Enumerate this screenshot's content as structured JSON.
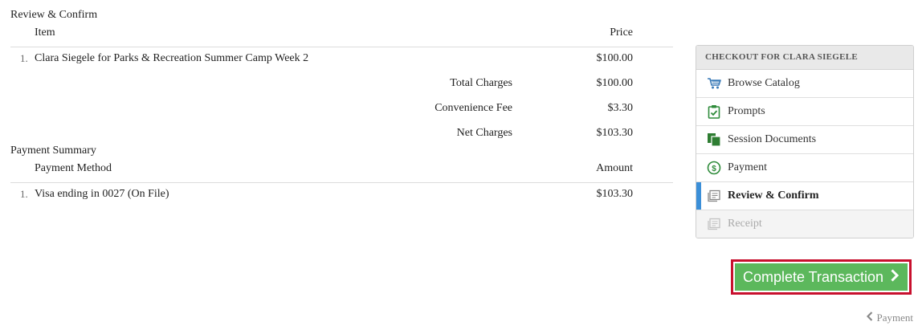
{
  "review": {
    "title": "Review & Confirm",
    "headers": {
      "item": "Item",
      "price": "Price"
    },
    "items": [
      {
        "num": "1.",
        "name": "Clara Siegele for Parks & Recreation Summer Camp Week 2",
        "price": "$100.00"
      }
    ],
    "totals": [
      {
        "label": "Total Charges",
        "value": "$100.00"
      },
      {
        "label": "Convenience Fee",
        "value": "$3.30"
      },
      {
        "label": "Net Charges",
        "value": "$103.30"
      }
    ]
  },
  "payment_summary": {
    "title": "Payment Summary",
    "headers": {
      "method": "Payment Method",
      "amount": "Amount"
    },
    "items": [
      {
        "num": "1.",
        "method": "Visa ending in 0027 (On File)",
        "amount": "$103.30"
      }
    ]
  },
  "sidebar": {
    "header": "CHECKOUT FOR CLARA SIEGELE",
    "items": [
      {
        "label": "Browse Catalog",
        "icon": "cart-icon",
        "state": "normal"
      },
      {
        "label": "Prompts",
        "icon": "clipboard-check-icon",
        "state": "normal"
      },
      {
        "label": "Session Documents",
        "icon": "documents-icon",
        "state": "normal"
      },
      {
        "label": "Payment",
        "icon": "dollar-circle-icon",
        "state": "normal"
      },
      {
        "label": "Review & Confirm",
        "icon": "receipt-icon",
        "state": "active"
      },
      {
        "label": "Receipt",
        "icon": "receipt-icon",
        "state": "disabled"
      }
    ]
  },
  "actions": {
    "complete_label": "Complete Transaction",
    "back_label": "Payment"
  },
  "colors": {
    "accent_green": "#5cb85c",
    "highlight_red": "#c8102e",
    "active_blue": "#3b8fd8"
  }
}
